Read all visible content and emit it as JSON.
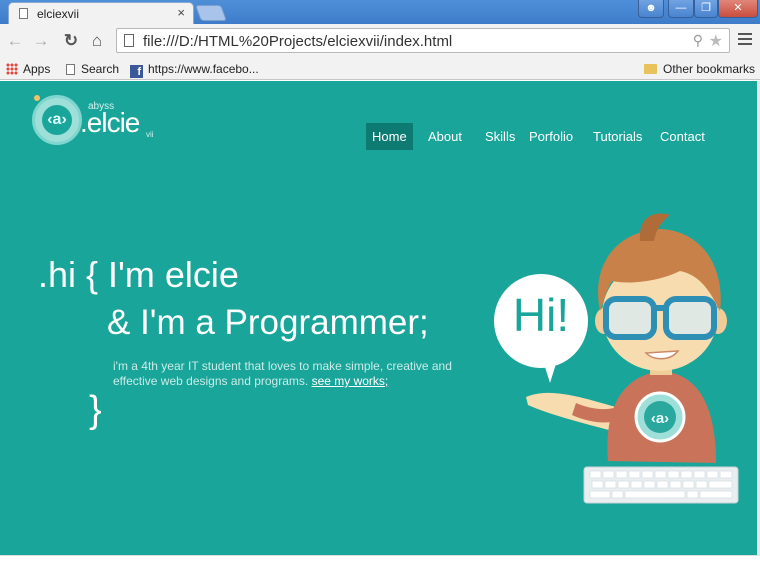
{
  "browser": {
    "tab_title": "elciexvii",
    "tab_close": "×",
    "url": "file:///D:/HTML%20Projects/elciexvii/index.html",
    "bookmarks": [
      {
        "label": "Apps"
      },
      {
        "label": "Search"
      },
      {
        "label": "https://www.facebo..."
      }
    ],
    "other_bookmarks": "Other bookmarks",
    "fb_glyph": "f"
  },
  "site": {
    "logo": {
      "abyss": "abyss",
      "name": ".elcie",
      "suffix": "vii",
      "mark": "‹a›"
    },
    "nav": [
      "Home",
      "About",
      "Skills",
      "Porfolio",
      "Tutorials",
      "Contact"
    ],
    "active_nav": "Home",
    "hero": {
      "line1": ".hi { I'm elcie",
      "line2": "& I'm a Programmer;",
      "desc": "i'm a 4th year IT student that loves to make simple, creative and effective web designs and programs.",
      "link": "see my works;",
      "closing": "}",
      "speech": "Hi!"
    },
    "colors": {
      "background": "#1aa59a",
      "nav_active": "#0d7b72",
      "hair": "#c9814a",
      "skin": "#f6dcae",
      "shirt": "#c9745a",
      "glasses": "#2e8fb4"
    }
  }
}
